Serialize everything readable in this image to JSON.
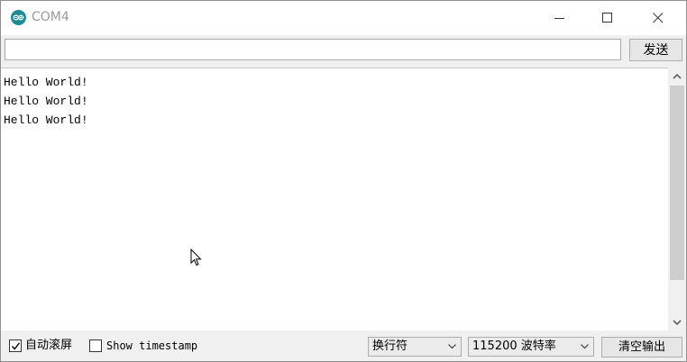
{
  "window": {
    "title": "COM4",
    "app_icon": "arduino-icon",
    "controls": [
      "minimize-icon",
      "maximize-icon",
      "close-icon"
    ]
  },
  "send": {
    "input_value": "",
    "button_label": "发送"
  },
  "output": {
    "lines": [
      "Hello World!",
      "Hello World!",
      "Hello World!"
    ]
  },
  "footer": {
    "autoscroll": {
      "label": "自动滚屏",
      "checked": true
    },
    "timestamp": {
      "label": "Show timestamp",
      "checked": false
    },
    "line_ending": {
      "selected": "换行符"
    },
    "baud_rate": {
      "selected": "115200 波特率"
    },
    "clear_button_label": "清空输出"
  },
  "colors": {
    "app_icon": "#1f8b96",
    "background": "#f0f0f0",
    "output_background": "#ffffff",
    "title_text": "#999999"
  }
}
